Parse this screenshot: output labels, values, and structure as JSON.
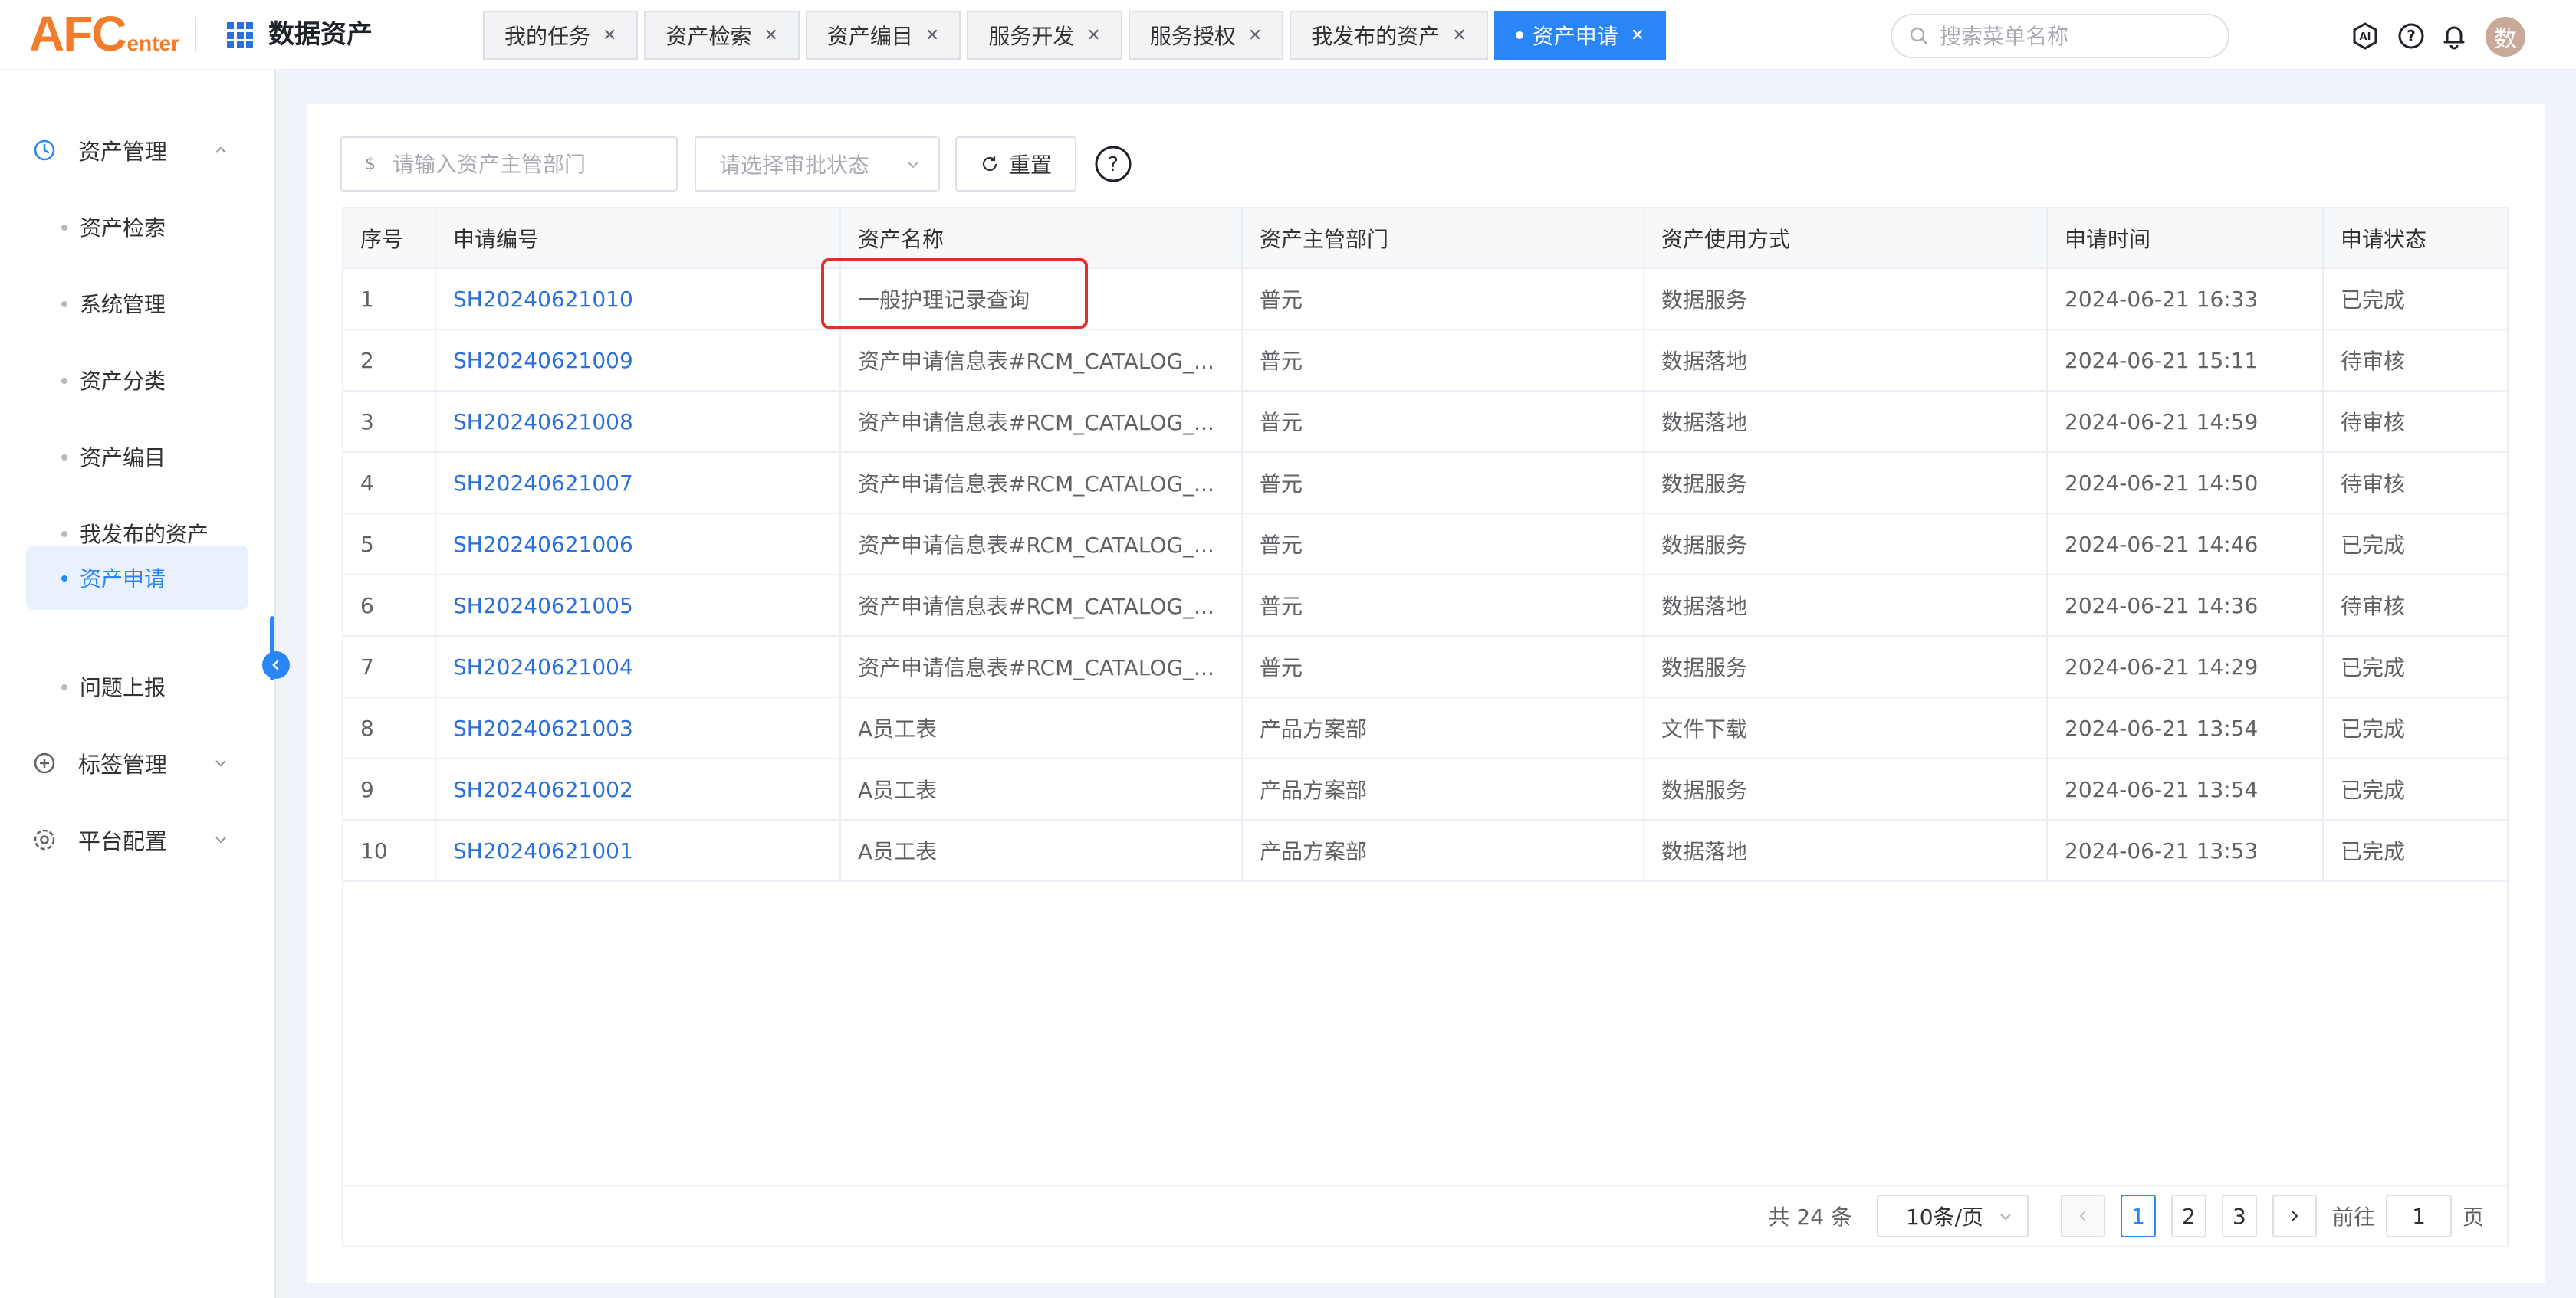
{
  "header": {
    "logo_main": "AFC",
    "logo_sub": "enter",
    "app_title": "数据资产",
    "tabs": [
      {
        "label": "我的任务",
        "active": false
      },
      {
        "label": "资产检索",
        "active": false
      },
      {
        "label": "资产编目",
        "active": false
      },
      {
        "label": "服务开发",
        "active": false
      },
      {
        "label": "服务授权",
        "active": false
      },
      {
        "label": "我发布的资产",
        "active": false
      },
      {
        "label": "资产申请",
        "active": true
      }
    ],
    "menu_search_placeholder": "搜索菜单名称",
    "avatar_text": "数",
    "icons": [
      "ai-icon",
      "help-icon",
      "bell-icon"
    ]
  },
  "sidebar": {
    "groups": [
      {
        "label": "资产管理",
        "icon": "clock-icon",
        "expanded": true
      },
      {
        "label": "标签管理",
        "icon": "plus-circle-icon",
        "expanded": false
      },
      {
        "label": "平台配置",
        "icon": "settings-icon",
        "expanded": false
      }
    ],
    "items": [
      {
        "label": "资产检索",
        "active": false
      },
      {
        "label": "系统管理",
        "active": false
      },
      {
        "label": "资产分类",
        "active": false
      },
      {
        "label": "资产编目",
        "active": false
      },
      {
        "label": "我发布的资产",
        "active": false
      },
      {
        "label": "资产申请",
        "active": true
      },
      {
        "label": "问题上报",
        "active": false
      }
    ]
  },
  "filters": {
    "dept_prefix": "$",
    "dept_placeholder": "请输入资产主管部门",
    "status_placeholder": "请选择审批状态",
    "reset_label": "重置"
  },
  "table": {
    "columns": [
      "序号",
      "申请编号",
      "资产名称",
      "资产主管部门",
      "资产使用方式",
      "申请时间",
      "申请状态"
    ],
    "rows": [
      [
        "1",
        "SH20240621010",
        "一般护理记录查询",
        "普元",
        "数据服务",
        "2024-06-21 16:33",
        "已完成"
      ],
      [
        "2",
        "SH20240621009",
        "资产申请信息表#RCM_CATALOG_...",
        "普元",
        "数据落地",
        "2024-06-21 15:11",
        "待审核"
      ],
      [
        "3",
        "SH20240621008",
        "资产申请信息表#RCM_CATALOG_...",
        "普元",
        "数据落地",
        "2024-06-21 14:59",
        "待审核"
      ],
      [
        "4",
        "SH20240621007",
        "资产申请信息表#RCM_CATALOG_...",
        "普元",
        "数据服务",
        "2024-06-21 14:50",
        "待审核"
      ],
      [
        "5",
        "SH20240621006",
        "资产申请信息表#RCM_CATALOG_...",
        "普元",
        "数据服务",
        "2024-06-21 14:46",
        "已完成"
      ],
      [
        "6",
        "SH20240621005",
        "资产申请信息表#RCM_CATALOG_...",
        "普元",
        "数据落地",
        "2024-06-21 14:36",
        "待审核"
      ],
      [
        "7",
        "SH20240621004",
        "资产申请信息表#RCM_CATALOG_...",
        "普元",
        "数据服务",
        "2024-06-21 14:29",
        "已完成"
      ],
      [
        "8",
        "SH20240621003",
        "A员工表",
        "产品方案部",
        "文件下载",
        "2024-06-21 13:54",
        "已完成"
      ],
      [
        "9",
        "SH20240621002",
        "A员工表",
        "产品方案部",
        "数据服务",
        "2024-06-21 13:54",
        "已完成"
      ],
      [
        "10",
        "SH20240621001",
        "A员工表",
        "产品方案部",
        "数据落地",
        "2024-06-21 13:53",
        "已完成"
      ]
    ]
  },
  "pagination": {
    "total_text": "共 24 条",
    "page_size": "10条/页",
    "pages": [
      "1",
      "2",
      "3"
    ],
    "current_page": "1",
    "goto_prefix": "前往",
    "goto_value": "1",
    "goto_suffix": "页"
  },
  "colors": {
    "accent": "#2a86f7",
    "link": "#2a6fdc",
    "logo": "#f07c2c",
    "highlight_box": "#e0302a"
  }
}
